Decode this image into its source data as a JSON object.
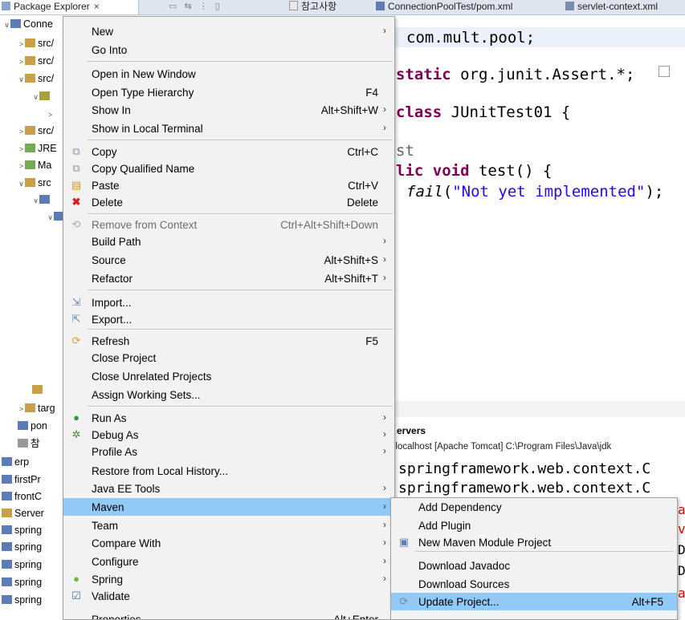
{
  "tabs": {
    "package_explorer": "Package Explorer",
    "close": "×",
    "editor_tabs": [
      "참고사항",
      "ConnectionPoolTest/pom.xml",
      "servlet-context.xml"
    ]
  },
  "tree": {
    "rows": [
      {
        "label": "Conne",
        "twisty": "∨"
      },
      {
        "label": "src/",
        "twisty": ">"
      },
      {
        "label": "src/",
        "twisty": ">"
      },
      {
        "label": "src/",
        "twisty": "∨"
      },
      {
        "label": "",
        "twisty": "∨"
      },
      {
        "label": "",
        "twisty": ">"
      },
      {
        "label": "src/",
        "twisty": ">"
      },
      {
        "label": "JRE",
        "twisty": ">"
      },
      {
        "label": "Ma",
        "twisty": ">"
      },
      {
        "label": "src",
        "twisty": "∨"
      },
      {
        "label": "",
        "twisty": "∨"
      },
      {
        "label": "",
        "twisty": "∨"
      }
    ],
    "bottom_rows": [
      {
        "label": "",
        "twisty": ""
      },
      {
        "label": "targ",
        "twisty": ">"
      },
      {
        "label": "pon",
        "twisty": ""
      },
      {
        "label": "참",
        "twisty": ""
      },
      {
        "label": "erp",
        "twisty": ""
      },
      {
        "label": "firstPr",
        "twisty": ""
      },
      {
        "label": "frontC",
        "twisty": ""
      },
      {
        "label": "Server",
        "twisty": ""
      },
      {
        "label": "spring",
        "twisty": ""
      },
      {
        "label": "spring",
        "twisty": ""
      },
      {
        "label": "spring",
        "twisty": ""
      },
      {
        "label": "spring",
        "twisty": ""
      },
      {
        "label": "spring",
        "twisty": ""
      }
    ]
  },
  "editor": {
    "line1": "com.mult.pool;",
    "line2_kw": "static",
    "line2_rest": " org.junit.Assert.*;",
    "line3_kw": "class",
    "line3_rest": " JUnitTest01 {",
    "line4": "st",
    "line5_kw1": "lic",
    "line5_kw2": "void",
    "line5_rest": " test() {",
    "line6_fn": "fail",
    "line6_str": "\"Not yet implemented\"",
    "line6_end": ");"
  },
  "console": {
    "title": "ervers",
    "path": "t localhost [Apache Tomcat] C:\\Program Files\\Java\\jdk",
    "line1": "springframework.web.context.C",
    "line2": "springframework.web.context.C"
  },
  "menu": {
    "new": "New",
    "go_into": "Go Into",
    "open_new_window": "Open in New Window",
    "open_type_hierarchy": "Open Type Hierarchy",
    "open_type_hierarchy_sc": "F4",
    "show_in": "Show In",
    "show_in_sc": "Alt+Shift+W",
    "show_local_terminal": "Show in Local Terminal",
    "copy": "Copy",
    "copy_sc": "Ctrl+C",
    "copy_qualified": "Copy Qualified Name",
    "paste": "Paste",
    "paste_sc": "Ctrl+V",
    "delete": "Delete",
    "delete_sc": "Delete",
    "remove_context": "Remove from Context",
    "remove_context_sc": "Ctrl+Alt+Shift+Down",
    "build_path": "Build Path",
    "source": "Source",
    "source_sc": "Alt+Shift+S",
    "refactor": "Refactor",
    "refactor_sc": "Alt+Shift+T",
    "import": "Import...",
    "export": "Export...",
    "refresh": "Refresh",
    "refresh_sc": "F5",
    "close_project": "Close Project",
    "close_unrelated": "Close Unrelated Projects",
    "assign_working_sets": "Assign Working Sets...",
    "run_as": "Run As",
    "debug_as": "Debug As",
    "profile_as": "Profile As",
    "restore_history": "Restore from Local History...",
    "java_ee_tools": "Java EE Tools",
    "maven": "Maven",
    "team": "Team",
    "compare_with": "Compare With",
    "configure": "Configure",
    "spring": "Spring",
    "validate": "Validate",
    "properties": "Properties",
    "properties_sc": "Alt+Enter"
  },
  "submenu": {
    "add_dependency": "Add Dependency",
    "add_plugin": "Add Plugin",
    "new_module": "New Maven Module Project",
    "download_javadoc": "Download Javadoc",
    "download_sources": "Download Sources",
    "update_project": "Update Project...",
    "update_project_sc": "Alt+F5"
  },
  "colors": {
    "highlight": "#91c9f7",
    "keyword": "#7f0055",
    "string": "#2a00ff",
    "menu_bg": "#f2f2f2"
  }
}
